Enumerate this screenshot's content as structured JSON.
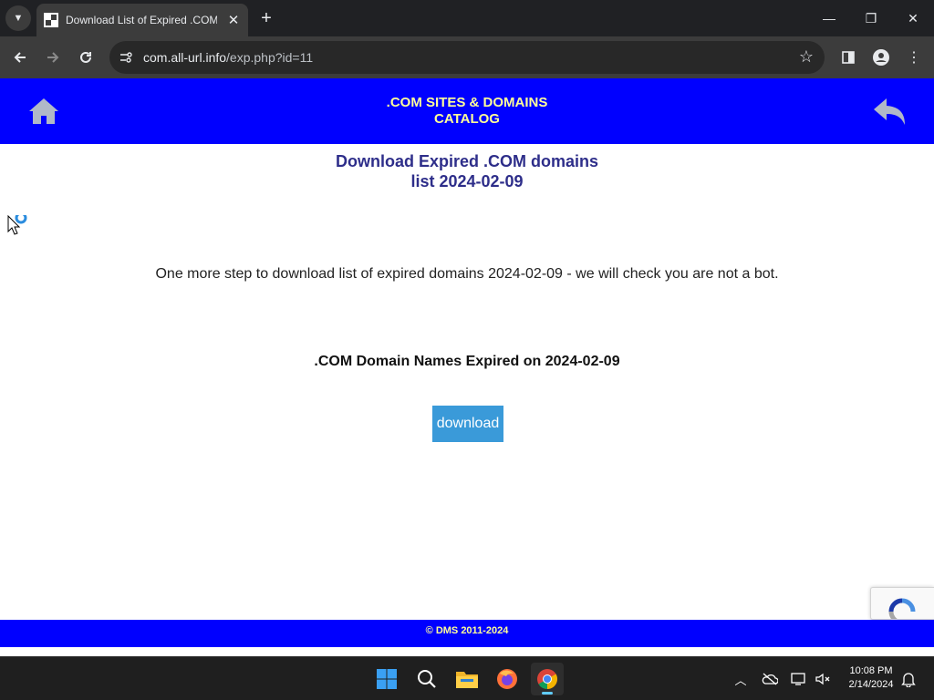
{
  "browser": {
    "tab": {
      "title": "Download List of Expired .COM",
      "close_icon": "close-icon",
      "favicon": "site-favicon"
    },
    "new_tab_label": "+",
    "address": {
      "host": "com.all-url.info",
      "path": "/exp.php?id=11"
    },
    "window_controls": {
      "minimize": "—",
      "restore": "❐",
      "close": "✕"
    }
  },
  "site": {
    "header": {
      "title_line1": ".COM SITES & DOMAINS",
      "title_line2": "CATALOG",
      "home_icon": "home-icon",
      "back_icon": "back-arrow-icon"
    },
    "main_title_line1": "Download Expired .COM domains",
    "main_title_line2": "list 2024-02-09",
    "step_text": "One more step to download list of expired domains 2024-02-09 - we will check you are not a bot.",
    "sub_heading": ".COM Domain Names Expired on 2024-02-09",
    "download_label": "download",
    "footer": "© DMS 2011-2024"
  },
  "colors": {
    "header_bg": "#0000ff",
    "header_text": "#ffff99",
    "title_text": "#2e2e8a",
    "button_bg": "#3a9ad9"
  },
  "taskbar": {
    "clock_time": "10:08 PM",
    "clock_date": "2/14/2024",
    "apps": [
      "windows-start-icon",
      "search-icon",
      "file-explorer-icon",
      "firefox-icon",
      "chrome-icon"
    ]
  }
}
